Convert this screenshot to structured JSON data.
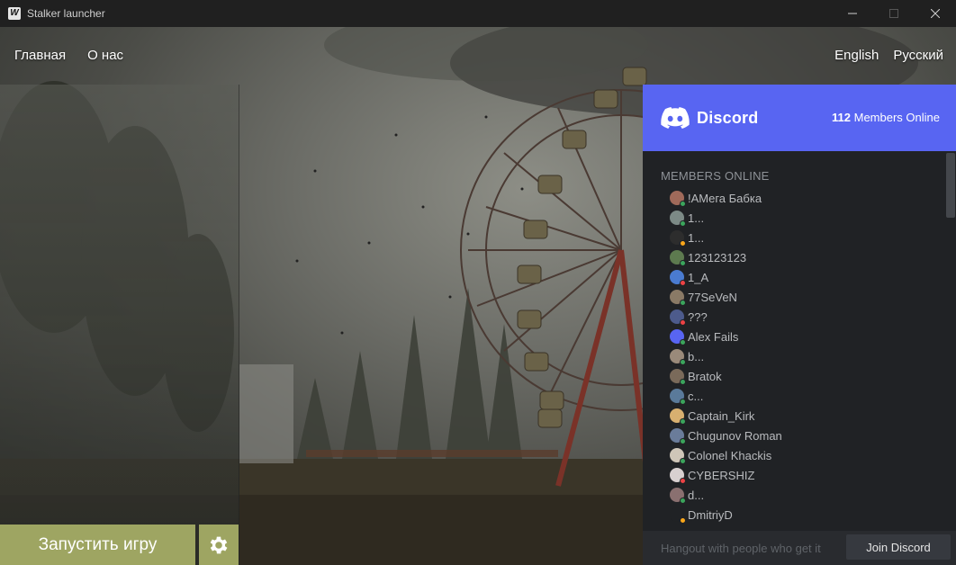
{
  "window": {
    "title": "Stalker launcher",
    "app_icon": "W"
  },
  "nav": {
    "home": "Главная",
    "about": "О нас",
    "lang_en": "English",
    "lang_ru": "Русский"
  },
  "launch": {
    "play_label": "Запустить игру"
  },
  "discord": {
    "brand": "Discord",
    "online_count": "112",
    "online_suffix": "Members Online",
    "members_title": "MEMBERS ONLINE",
    "members": [
      {
        "name": "!AMега Бабка",
        "avatar_color": "#a06a5a",
        "status": "#3ba55c"
      },
      {
        "name": "1...",
        "avatar_color": "#7c8a86",
        "status": "#3ba55c"
      },
      {
        "name": "1...",
        "avatar_color": "#2d2d2d",
        "status": "#faa61a"
      },
      {
        "name": "123123123",
        "avatar_color": "#5d7a4f",
        "status": "#3ba55c"
      },
      {
        "name": "1_A",
        "avatar_color": "#4a7bd0",
        "status": "#ed4245"
      },
      {
        "name": "77SeVeN",
        "avatar_color": "#8a7a66",
        "status": "#3ba55c"
      },
      {
        "name": "???",
        "avatar_color": "#4d5b8c",
        "status": "#ed4245"
      },
      {
        "name": "Alex Fails",
        "avatar_color": "#5865f2",
        "status": "#3ba55c"
      },
      {
        "name": "b...",
        "avatar_color": "#9a8a7a",
        "status": "#3ba55c"
      },
      {
        "name": "Bratok",
        "avatar_color": "#7a6a5a",
        "status": "#3ba55c"
      },
      {
        "name": "c...",
        "avatar_color": "#5a7a9a",
        "status": "#3ba55c"
      },
      {
        "name": "Captain_Kirk",
        "avatar_color": "#d8b070",
        "status": "#3ba55c"
      },
      {
        "name": "Chugunov Roman",
        "avatar_color": "#6a7c9a",
        "status": "#3ba55c"
      },
      {
        "name": "Colonel Khackis",
        "avatar_color": "#cfc6b8",
        "status": "#3ba55c"
      },
      {
        "name": "CYBERSHIZ",
        "avatar_color": "#d8d0d0",
        "status": "#ed4245"
      },
      {
        "name": "d...",
        "avatar_color": "#8a7070",
        "status": "#3ba55c"
      },
      {
        "name": "DmitriyD",
        "avatar_color": "#202225",
        "status": "#faa61a"
      }
    ],
    "footer_text": "Hangout with people who get it",
    "join_label": "Join Discord"
  },
  "icons": {
    "minimize": "minimize-icon",
    "maximize": "maximize-icon",
    "close": "close-icon",
    "settings": "gear-icon",
    "discord": "discord-logo-icon"
  },
  "colors": {
    "accent_green": "#9ea562",
    "discord_blurple": "#5865f2",
    "discord_bg": "#202225"
  }
}
